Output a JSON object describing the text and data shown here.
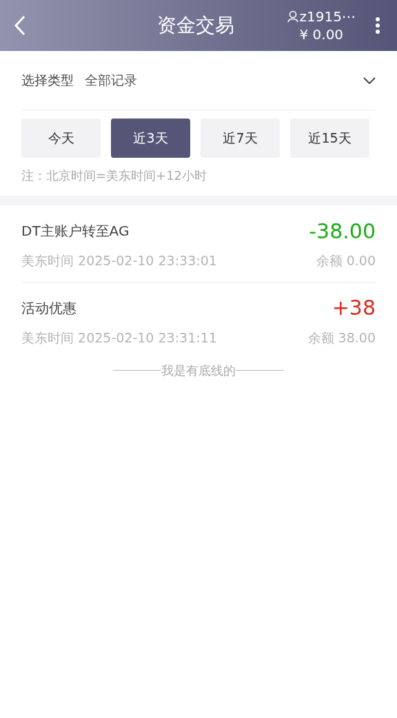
{
  "header": {
    "title": "资金交易",
    "username": "z1915⋯",
    "balance": "¥ 0.00"
  },
  "filter": {
    "label": "选择类型",
    "value": "全部记录"
  },
  "ranges": [
    {
      "label": "今天",
      "selected": false
    },
    {
      "label": "近3天",
      "selected": true
    },
    {
      "label": "近7天",
      "selected": false
    },
    {
      "label": "近15天",
      "selected": false
    }
  ],
  "note": "注：北京时间=美东时间+12小时",
  "transactions": [
    {
      "title": "DT主账户转至AG",
      "amount": "-38.00",
      "kind": "debit",
      "time": "美东时间 2025-02-10 23:33:01",
      "balance": "余额 0.00"
    },
    {
      "title": "活动优惠",
      "amount": "+38",
      "kind": "credit",
      "time": "美东时间 2025-02-10 23:31:11",
      "balance": "余额 38.00"
    }
  ],
  "end_text": "我是有底线的"
}
